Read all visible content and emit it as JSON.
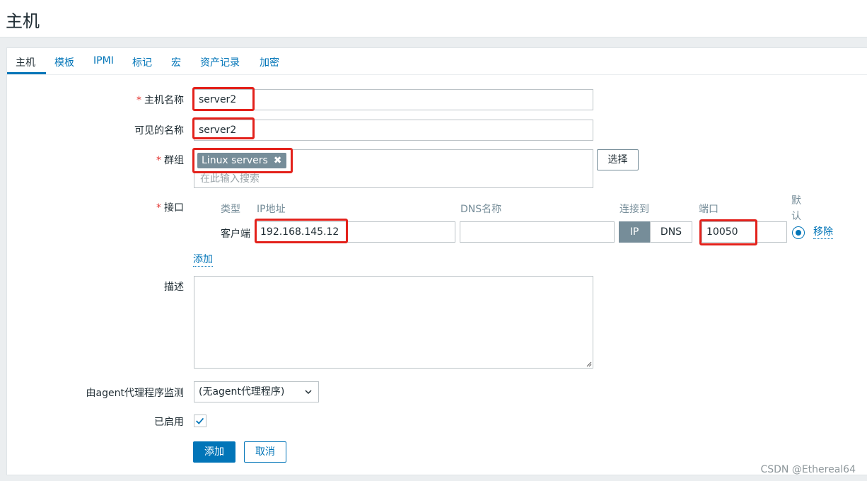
{
  "page_title": "主机",
  "tabs": [
    {
      "label": "主机",
      "active": true
    },
    {
      "label": "模板"
    },
    {
      "label": "IPMI"
    },
    {
      "label": "标记"
    },
    {
      "label": "宏"
    },
    {
      "label": "资产记录"
    },
    {
      "label": "加密"
    }
  ],
  "form": {
    "required_mark": "*",
    "host_name": {
      "label": "主机名称",
      "value": "server2"
    },
    "visible_name": {
      "label": "可见的名称",
      "value": "server2"
    },
    "groups": {
      "label": "群组",
      "tag": "Linux servers",
      "tag_remove": "✖",
      "placeholder": "在此输入搜索",
      "select_button": "选择"
    },
    "interfaces": {
      "label": "接口",
      "headers": {
        "type": "类型",
        "ip": "IP地址",
        "dns": "DNS名称",
        "connect_to": "连接到",
        "port": "端口",
        "default": "默认"
      },
      "row": {
        "type": "客户端",
        "ip": "192.168.145.12",
        "dns": "",
        "connect_ip": "IP",
        "connect_dns": "DNS",
        "port": "10050",
        "remove": "移除"
      },
      "add_link": "添加"
    },
    "description": {
      "label": "描述",
      "value": ""
    },
    "proxy": {
      "label": "由agent代理程序监测",
      "selected": "(无agent代理程序)"
    },
    "enabled": {
      "label": "已启用",
      "checked": true
    },
    "buttons": {
      "add": "添加",
      "cancel": "取消"
    }
  },
  "watermark": "CSDN @Ethereal64",
  "colors": {
    "link": "#0275b8",
    "highlight": "#e3211b",
    "tag_bg": "#768d99",
    "required": "#e33734"
  }
}
